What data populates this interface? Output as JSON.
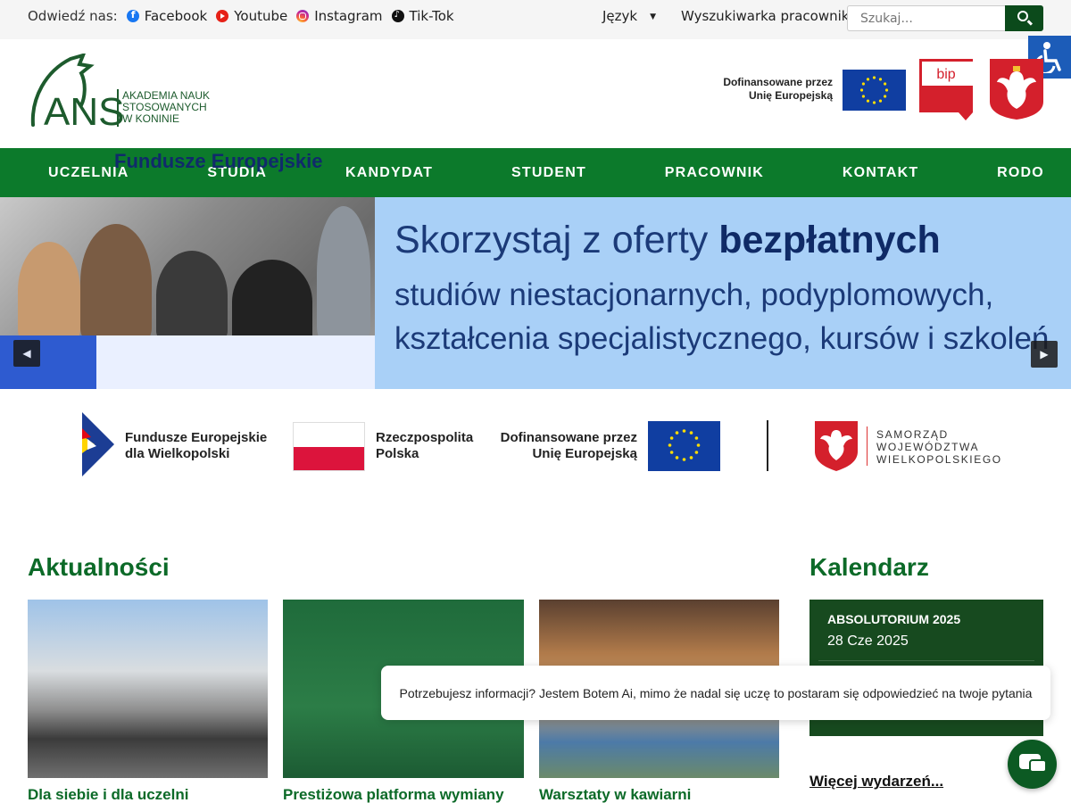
{
  "topbar": {
    "follow_label": "Odwiedź nas:",
    "social": [
      "Facebook",
      "Youtube",
      "Instagram",
      "Tik-Tok"
    ],
    "language_label": "Język",
    "staff_search_label": "Wyszukiwarka pracowników",
    "search_placeholder": "Szukaj..."
  },
  "header": {
    "logo_name": "ANS",
    "logo_line1": "AKADEMIA NAUK",
    "logo_line2": "STOSOWANYCH",
    "logo_line3": "W KONINIE",
    "cofund_line1": "Dofinansowane przez",
    "cofund_line2": "Unię Europejską",
    "bip_label": "bip"
  },
  "nav": [
    "UCZELNIA",
    "STUDIA",
    "KANDYDAT",
    "STUDENT",
    "PRACOWNIK",
    "KONTAKT",
    "RODO"
  ],
  "hero": {
    "line1_pre": "Skorzystaj z oferty ",
    "line1_bold": "bezpłatnych",
    "line2": "studiów niestacjonarnych, podyplomowych,",
    "line3": "kształcenia specjalistycznego, kursów i szkoleń",
    "badge": "Fundusze Europejskie"
  },
  "funding": {
    "fe_line1": "Fundusze Europejskie",
    "fe_line2": "dla Wielkopolski",
    "rp_line1": "Rzeczpospolita",
    "rp_line2": "Polska",
    "eu_line1": "Dofinansowane przez",
    "eu_line2": "Unię Europejską",
    "wlkp_line1": "SAMORZĄD",
    "wlkp_line2": "WOJEWÓDZTWA",
    "wlkp_line3": "WIELKOPOLSKIEGO"
  },
  "news": {
    "heading": "Aktualności",
    "cards": [
      {
        "title": "Dla siebie i dla uczelni"
      },
      {
        "title": "Prestiżowa platforma wymiany"
      },
      {
        "title": "Warsztaty w kawiarni"
      }
    ]
  },
  "calendar": {
    "heading": "Kalendarz",
    "event_title": "ABSOLUTORIUM 2025",
    "event_date": "28 Cze 2025",
    "more_label": "Więcej wydarzeń..."
  },
  "chatbot": {
    "message": "Potrzebujesz informacji? Jestem Botem Ai, mimo że nadal się uczę to postaram się odpowiedzieć na twoje pytania"
  },
  "colors": {
    "nav_green": "#0c7a2b",
    "heading_green": "#0c6a28",
    "calendar_bg": "#174a1f",
    "a11y_blue": "#1c5cb8"
  }
}
